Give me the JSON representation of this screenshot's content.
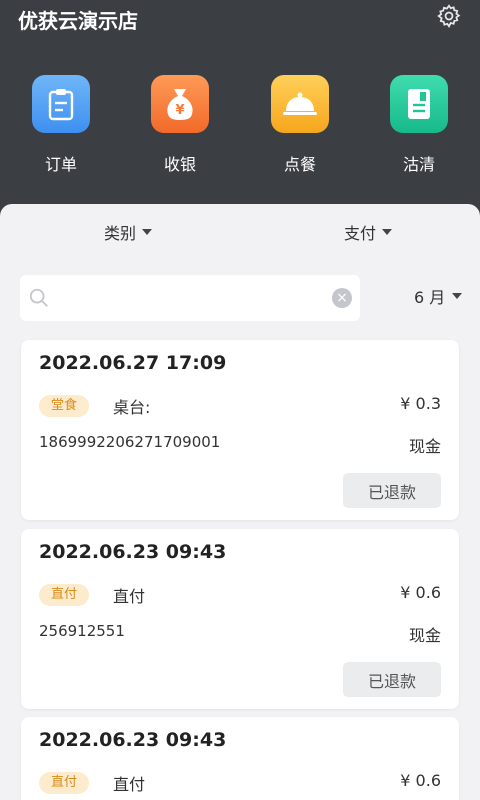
{
  "app": {
    "title": "优获云演示店",
    "settings_icon": "gear-icon"
  },
  "quick_actions": [
    {
      "label": "订单",
      "icon": "clipboard-icon",
      "color": "#4a9cf2"
    },
    {
      "label": "收银",
      "icon": "money-bag-icon",
      "color": "#f47a38"
    },
    {
      "label": "点餐",
      "icon": "serving-cloche-icon",
      "color": "#f8b430"
    },
    {
      "label": "沽清",
      "icon": "notebook-icon",
      "color": "#23c495"
    }
  ],
  "filters": {
    "category": "类别",
    "payment": "支付",
    "month": "6 月"
  },
  "search": {
    "value": "",
    "placeholder": ""
  },
  "orders": [
    {
      "datetime": "2022.06.27 17:09",
      "tag": "堂食",
      "table": "桌台:",
      "amount": "¥ 0.3",
      "order_no": "1869992206271709001",
      "pay_method": "现金",
      "action": "已退款"
    },
    {
      "datetime": "2022.06.23 09:43",
      "tag": "直付",
      "table": "直付",
      "amount": "¥ 0.6",
      "order_no": "256912551",
      "pay_method": "现金",
      "action": "已退款"
    },
    {
      "datetime": "2022.06.23 09:43",
      "tag": "直付",
      "table": "直付",
      "amount": "¥ 0.6",
      "order_no": "",
      "pay_method": "",
      "action": ""
    }
  ]
}
